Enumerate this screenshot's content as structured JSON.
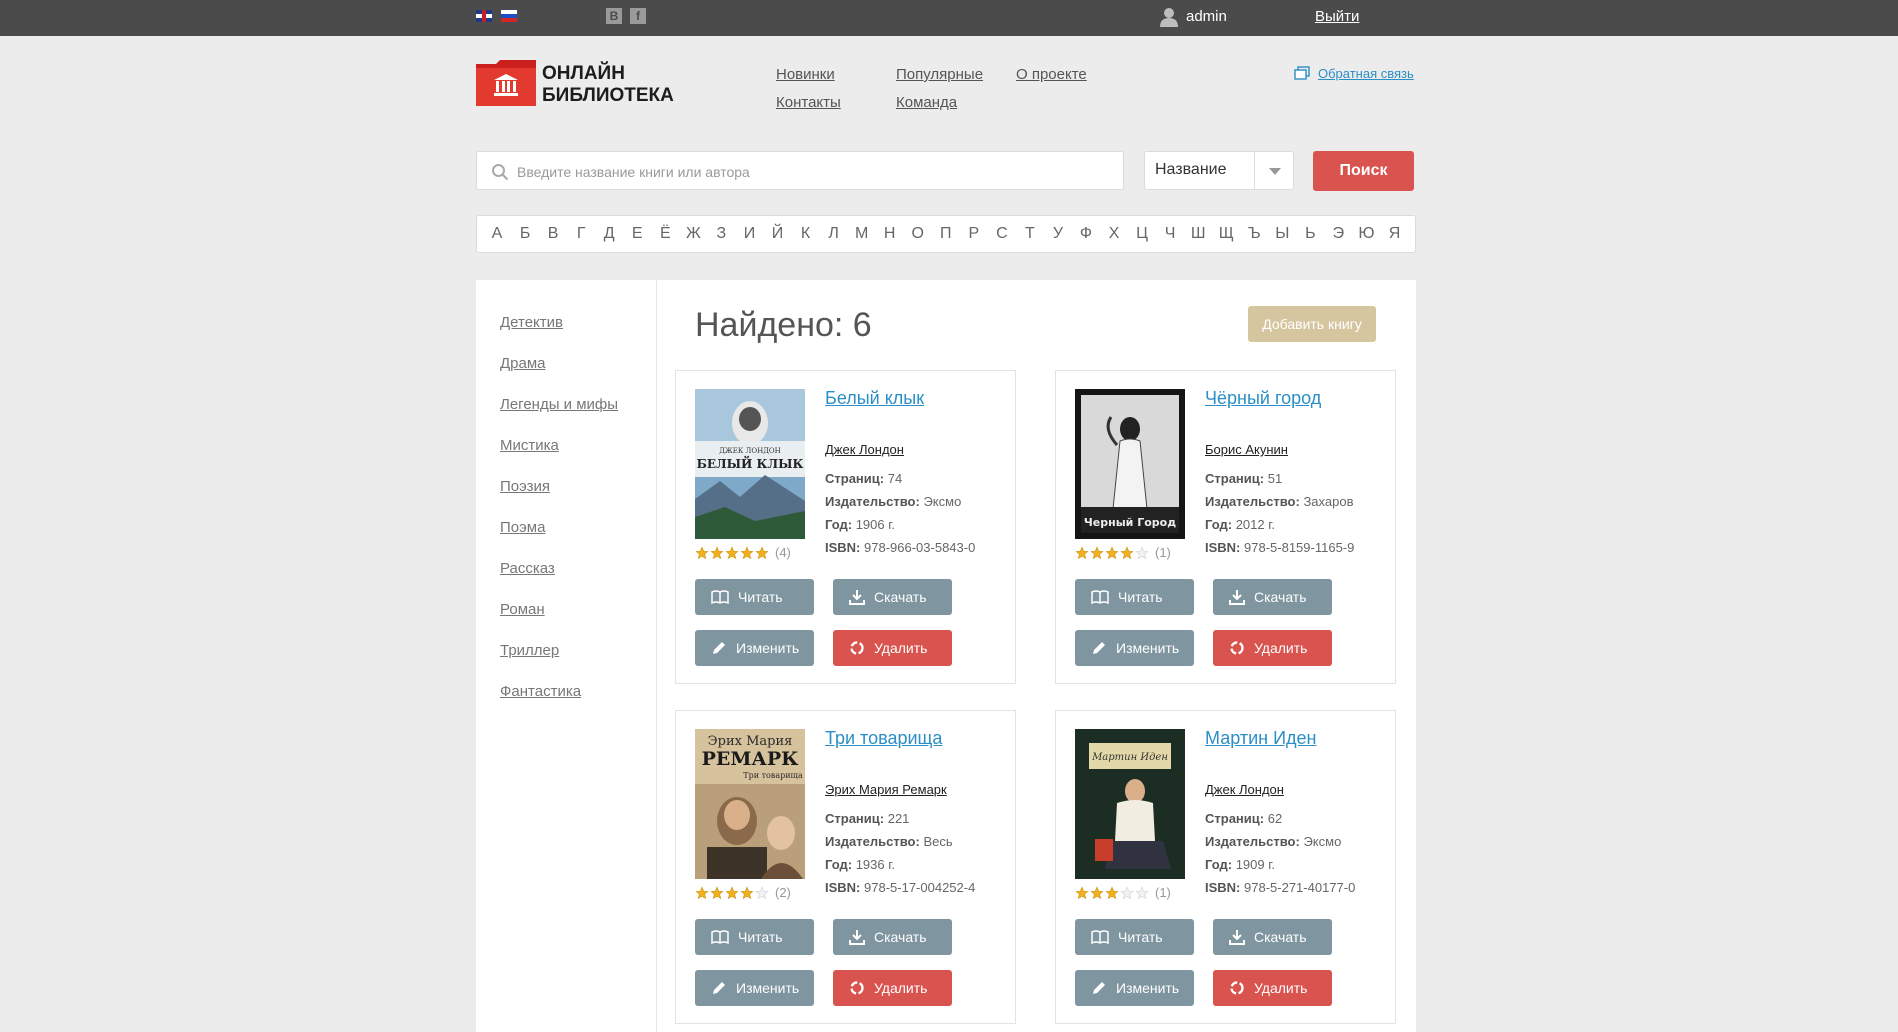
{
  "topbar": {
    "user": "admin",
    "logout": "Выйти",
    "social_vk": "B",
    "social_fb": "f"
  },
  "header": {
    "logo_line1": "ОНЛАЙН",
    "logo_line2": "БИБЛИОТЕКА",
    "nav": [
      "Новинки",
      "Популярные",
      "О проекте",
      "Контакты",
      "Команда"
    ],
    "feedback": "Обратная связь"
  },
  "search": {
    "placeholder": "Введите название книги или автора",
    "value": "",
    "select": "Название",
    "button": "Поиск"
  },
  "alphabet": [
    "А",
    "Б",
    "В",
    "Г",
    "Д",
    "Е",
    "Ё",
    "Ж",
    "З",
    "И",
    "Й",
    "К",
    "Л",
    "М",
    "Н",
    "О",
    "П",
    "Р",
    "С",
    "Т",
    "У",
    "Ф",
    "Х",
    "Ц",
    "Ч",
    "Ш",
    "Щ",
    "Ъ",
    "Ы",
    "Ь",
    "Э",
    "Ю",
    "Я"
  ],
  "genres": [
    "Детектив",
    "Драма",
    "Легенды и мифы",
    "Мистика",
    "Поэзия",
    "Поэма",
    "Рассказ",
    "Роман",
    "Триллер",
    "Фантастика"
  ],
  "results": {
    "found": "Найдено: 6",
    "add_button": "Добавить книгу"
  },
  "labels": {
    "pages": "Страниц:",
    "publisher": "Издательство:",
    "year": "Год:",
    "isbn": "ISBN:",
    "read": "Читать",
    "download": "Скачать",
    "edit": "Изменить",
    "delete": "Удалить"
  },
  "books": [
    {
      "title": "Белый клык",
      "author": "Джек Лондон",
      "pages": "74",
      "publisher": "Эксмо",
      "year": "1906 г.",
      "isbn": "978-966-03-5843-0",
      "rating": 5,
      "votes": "(4)",
      "cover_text": "ДЖЕК ЛОНДОН БЕЛЫЙ КЛЫК"
    },
    {
      "title": "Чёрный город",
      "author": "Борис Акунин",
      "pages": "51",
      "publisher": "Захаров",
      "year": "2012 г.",
      "isbn": "978-5-8159-1165-9",
      "rating": 4,
      "votes": "(1)",
      "cover_text": "Черный Город"
    },
    {
      "title": "Три товарища",
      "author": "Эрих Мария Ремарк",
      "pages": "221",
      "publisher": "Весь",
      "year": "1936 г.",
      "isbn": "978-5-17-004252-4",
      "rating": 4,
      "votes": "(2)",
      "cover_text": "Эрих Мария РЕМАРК Три товарища"
    },
    {
      "title": "Мартин Иден",
      "author": "Джек Лондон",
      "pages": "62",
      "publisher": "Эксмо",
      "year": "1909 г.",
      "isbn": "978-5-271-40177-0",
      "rating": 3,
      "votes": "(1)",
      "cover_text": "Мартин Иден"
    }
  ],
  "colors": {
    "topbar": "#4b4b4b",
    "accent_red": "#d9534f",
    "link_blue": "#2b8fc7",
    "button_gray": "#7f95a0",
    "add_button": "#d6c6a0",
    "star": "#f2b01e"
  }
}
